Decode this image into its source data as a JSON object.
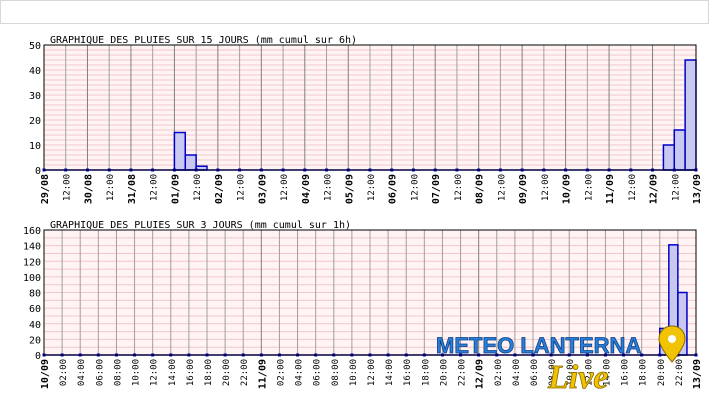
{
  "chart_data": [
    {
      "type": "bar",
      "title": "GRAPHIQUE DES PLUIES SUR 15 JOURS (mm cumul sur 6h)",
      "ylim": [
        0,
        50
      ],
      "yticks": [
        0,
        10,
        20,
        30,
        40,
        50
      ],
      "x_tick_labels": [
        "29/08",
        "12:00",
        "30/08",
        "12:00",
        "31/08",
        "12:00",
        "01/09",
        "12:00",
        "02/09",
        "12:00",
        "03/09",
        "12:00",
        "04/09",
        "12:00",
        "05/09",
        "12:00",
        "06/09",
        "12:00",
        "07/09",
        "12:00",
        "08/09",
        "12:00",
        "09/09",
        "12:00",
        "10/09",
        "12:00",
        "11/09",
        "12:00",
        "12/09",
        "12:00",
        "13/09"
      ],
      "bar_interval": "6h",
      "series": [
        {
          "values": [
            0,
            0,
            0,
            0,
            0,
            0,
            0,
            0,
            0,
            0,
            0,
            0,
            15,
            6,
            1.5,
            0,
            0,
            0,
            0,
            0,
            0,
            0,
            0,
            0,
            0,
            0,
            0,
            0,
            0,
            0,
            0,
            0,
            0,
            0,
            0,
            0,
            0,
            0,
            0,
            0,
            0,
            0,
            0,
            0,
            0,
            0,
            0,
            0,
            0,
            0,
            0,
            0,
            0,
            0,
            0,
            0,
            0,
            10,
            16,
            44
          ]
        }
      ],
      "bar_color": "#c8c8f0",
      "line_color": "#0000c8",
      "grid": true
    },
    {
      "type": "bar",
      "title": "GRAPHIQUE DES PLUIES SUR 3 JOURS (mm cumul sur 1h)",
      "ylim": [
        0,
        160
      ],
      "yticks": [
        0,
        20,
        40,
        60,
        80,
        100,
        120,
        140,
        160
      ],
      "x_tick_labels": [
        "10/09",
        "02:00",
        "04:00",
        "06:00",
        "08:00",
        "10:00",
        "12:00",
        "14:00",
        "16:00",
        "18:00",
        "20:00",
        "22:00",
        "11/09",
        "02:00",
        "04:00",
        "06:00",
        "08:00",
        "10:00",
        "12:00",
        "14:00",
        "16:00",
        "18:00",
        "20:00",
        "22:00",
        "12/09",
        "02:00",
        "04:00",
        "06:00",
        "08:00",
        "10:00",
        "12:00",
        "14:00",
        "16:00",
        "18:00",
        "20:00",
        "22:00",
        "13/09"
      ],
      "bar_interval": "1h",
      "series": [
        {
          "values": [
            0,
            0,
            0,
            0,
            0,
            0,
            0,
            0,
            0,
            0,
            0,
            0,
            0,
            0,
            0,
            0,
            0,
            0,
            0,
            0,
            0,
            0,
            0,
            0,
            0,
            0,
            0,
            0,
            0,
            0,
            0,
            0,
            0,
            0,
            0,
            0,
            0,
            0,
            0,
            0,
            0,
            0,
            0,
            0,
            0,
            0,
            0,
            0,
            0,
            0,
            0,
            0,
            0,
            0,
            0,
            0,
            0,
            0,
            0,
            0,
            0,
            0,
            0,
            0,
            0,
            0,
            0,
            0,
            34,
            141,
            80,
            0
          ]
        }
      ],
      "bar_color": "#c8c8f0",
      "line_color": "#0000c8",
      "grid": true
    }
  ],
  "watermark": {
    "line1": "METEO LANTERNA",
    "line2": "Live",
    "colors": {
      "blue": "#2a7fd6",
      "yellow": "#f2c300"
    }
  },
  "colors": {
    "plot_bg": "#fff3f3",
    "minor_grid": "#f0c8c8",
    "major_grid": "#a0a0a0",
    "bar_fill": "#c8c8f0",
    "bar_line": "#0000c8"
  }
}
